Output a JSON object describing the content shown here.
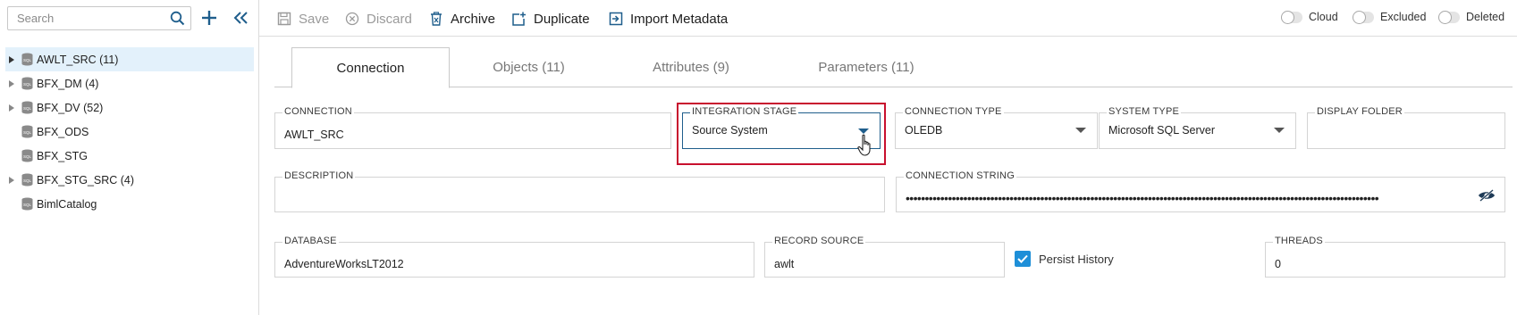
{
  "search": {
    "placeholder": "Search"
  },
  "tree": [
    {
      "label": "AWLT_SRC (11)",
      "expandable": true,
      "selected": true
    },
    {
      "label": "BFX_DM (4)",
      "expandable": true,
      "selected": false
    },
    {
      "label": "BFX_DV (52)",
      "expandable": true,
      "selected": false
    },
    {
      "label": "BFX_ODS",
      "expandable": false,
      "selected": false
    },
    {
      "label": "BFX_STG",
      "expandable": false,
      "selected": false
    },
    {
      "label": "BFX_STG_SRC (4)",
      "expandable": true,
      "selected": false
    },
    {
      "label": "BimlCatalog",
      "expandable": false,
      "selected": false
    }
  ],
  "toolbar": {
    "save": "Save",
    "discard": "Discard",
    "archive": "Archive",
    "duplicate": "Duplicate",
    "import_metadata": "Import Metadata",
    "toggle_cloud": "Cloud",
    "toggle_excluded": "Excluded",
    "toggle_deleted": "Deleted"
  },
  "tabs": {
    "connection": "Connection",
    "objects": "Objects (11)",
    "attributes": "Attributes (9)",
    "parameters": "Parameters (11)"
  },
  "form": {
    "connection": {
      "label": "CONNECTION",
      "value": "AWLT_SRC"
    },
    "integration_stage": {
      "label": "INTEGRATION STAGE",
      "value": "Source System"
    },
    "connection_type": {
      "label": "CONNECTION TYPE",
      "value": "OLEDB"
    },
    "system_type": {
      "label": "SYSTEM TYPE",
      "value": "Microsoft SQL Server"
    },
    "display_folder": {
      "label": "DISPLAY FOLDER",
      "value": ""
    },
    "description": {
      "label": "DESCRIPTION",
      "value": ""
    },
    "connection_string": {
      "label": "CONNECTION STRING",
      "value": "•••••••••••••••••••••••••••••••••••••••••••••••••••••••••••••••••••••••••••••••••••••••••••••••••••••••••••••••••••••••••••"
    },
    "database": {
      "label": "DATABASE",
      "value": "AdventureWorksLT2012"
    },
    "record_source": {
      "label": "RECORD SOURCE",
      "value": "awlt"
    },
    "persist_history": {
      "label": "Persist History",
      "checked": true
    },
    "threads": {
      "label": "THREADS",
      "value": "0"
    }
  },
  "colors": {
    "accent": "#1e8fd8",
    "highlight": "#c8102e",
    "selected_row": "#e3f1fb"
  }
}
